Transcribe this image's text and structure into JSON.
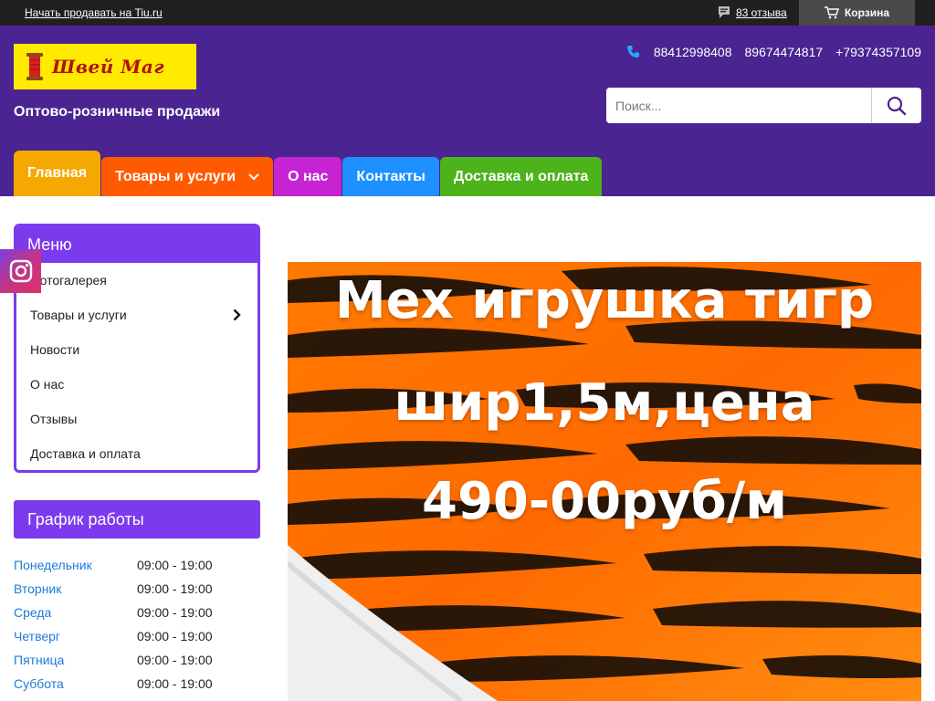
{
  "topbar": {
    "sell_link": "Начать продавать на Tiu.ru",
    "reviews_link": "83 отзыва",
    "cart_label": "Корзина"
  },
  "header": {
    "logo_text": "Швей Маг",
    "tagline": "Оптово-розничные продажи",
    "phones": [
      "88412998408",
      "89674474817",
      "+79374357109"
    ],
    "search_placeholder": "Поиск..."
  },
  "nav": {
    "items": [
      {
        "label": "Главная",
        "color": "#f5a800"
      },
      {
        "label": "Товары и услуги",
        "color": "#ff5a00"
      },
      {
        "label": "О нас",
        "color": "#c624d2"
      },
      {
        "label": "Контакты",
        "color": "#1e90ff"
      },
      {
        "label": "Доставка и оплата",
        "color": "#4db31b"
      }
    ]
  },
  "sidebar": {
    "menu_title": "Меню",
    "menu_items": [
      "Фотогалерея",
      "Товары и услуги",
      "Новости",
      "О нас",
      "Отзывы",
      "Доставка и оплата"
    ],
    "schedule_title": "График работы",
    "schedule": [
      {
        "day": "Понедельник",
        "hours": "09:00 - 19:00"
      },
      {
        "day": "Вторник",
        "hours": "09:00 - 19:00"
      },
      {
        "day": "Среда",
        "hours": "09:00 - 19:00"
      },
      {
        "day": "Четверг",
        "hours": "09:00 - 19:00"
      },
      {
        "day": "Пятница",
        "hours": "09:00 - 19:00"
      },
      {
        "day": "Суббота",
        "hours": "09:00 - 19:00"
      }
    ]
  },
  "banner": {
    "line1": "Мех игрушка тигр",
    "line2": "шир1,5м,цена",
    "line3": "490-00руб/м"
  },
  "colors": {
    "header_bg": "#4a2490",
    "accent_purple": "#7c3aed",
    "link_blue": "#1e7bd6",
    "logo_yellow": "#ffea00"
  }
}
